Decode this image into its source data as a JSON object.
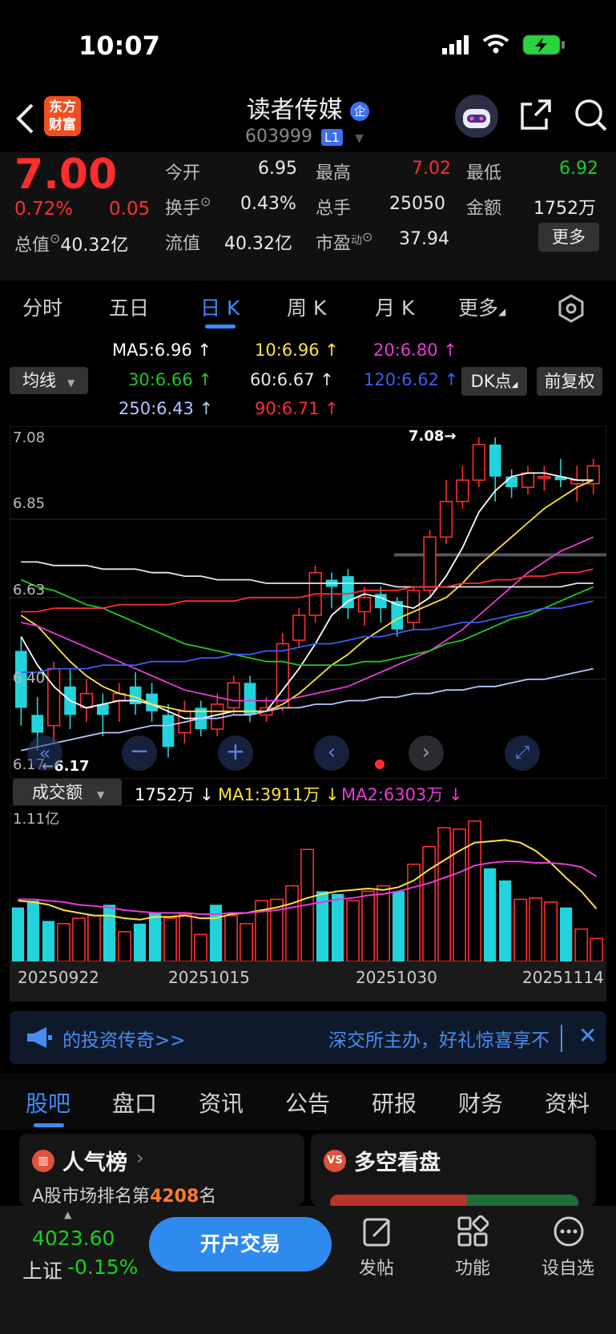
{
  "status_bar": {
    "time": "10:07"
  },
  "header": {
    "app_logo": "东方财富",
    "stock_name": "读者传媒",
    "name_badge": "企",
    "stock_code": "603999",
    "level_badge": "L1"
  },
  "quote": {
    "price": "7.00",
    "change_pct": "0.72%",
    "change_amt": "0.05",
    "open_label": "今开",
    "open": "6.95",
    "high_label": "最高",
    "high": "7.02",
    "low_label": "最低",
    "low": "6.92",
    "turnover_label": "换手",
    "turnover": "0.43%",
    "volume_label": "总手",
    "volume": "25050",
    "amount_label": "金额",
    "amount": "1752万",
    "total_cap_label": "总值",
    "total_cap": "40.32亿",
    "float_cap_label": "流值",
    "float_cap": "40.32亿",
    "pe_label": "市盈",
    "pe_sup": "动",
    "pe": "37.94",
    "more_button": "更多"
  },
  "period_tabs": [
    "分时",
    "五日",
    "日 K",
    "周 K",
    "月 K",
    "更多"
  ],
  "ma_legend": {
    "selector": "均线",
    "items": [
      {
        "text": "MA5:6.96 ↑",
        "color": "#ffffff"
      },
      {
        "text": "10:6.96 ↑",
        "color": "#ffe23a"
      },
      {
        "text": "20:6.80 ↑",
        "color": "#e83ad9"
      },
      {
        "text": "30:6.66 ↑",
        "color": "#1fc81f"
      },
      {
        "text": "60:6.67 ↑",
        "color": "#e6e6e6"
      },
      {
        "text": "120:6.62 ↑",
        "color": "#3a5ef5"
      },
      {
        "text": "250:6.43 ↑",
        "color": "#b3c8ff"
      },
      {
        "text": "90:6.71 ↑",
        "color": "#ff2d2d"
      }
    ],
    "dk_button": "DK点",
    "fq_button": "前复权"
  },
  "chart_data": [
    {
      "type": "candlestick",
      "y_ticks": [
        "7.08",
        "6.85",
        "6.63",
        "6.40",
        "6.17"
      ],
      "ylim": [
        6.17,
        7.08
      ],
      "max_label": "7.08→",
      "min_label": "←6.17",
      "x_labels": [
        "20250922",
        "20251015",
        "20251030",
        "20251114"
      ],
      "candles": [
        {
          "o": 6.48,
          "c": 6.32,
          "h": 6.52,
          "l": 6.27
        },
        {
          "o": 6.3,
          "c": 6.25,
          "h": 6.35,
          "l": 6.2
        },
        {
          "o": 6.27,
          "c": 6.43,
          "h": 6.45,
          "l": 6.22
        },
        {
          "o": 6.38,
          "c": 6.3,
          "h": 6.43,
          "l": 6.26
        },
        {
          "o": 6.32,
          "c": 6.36,
          "h": 6.4,
          "l": 6.28
        },
        {
          "o": 6.33,
          "c": 6.3,
          "h": 6.36,
          "l": 6.24
        },
        {
          "o": 6.34,
          "c": 6.36,
          "h": 6.39,
          "l": 6.28
        },
        {
          "o": 6.38,
          "c": 6.33,
          "h": 6.42,
          "l": 6.3
        },
        {
          "o": 6.36,
          "c": 6.31,
          "h": 6.39,
          "l": 6.28
        },
        {
          "o": 6.3,
          "c": 6.21,
          "h": 6.33,
          "l": 6.18
        },
        {
          "o": 6.25,
          "c": 6.31,
          "h": 6.34,
          "l": 6.22
        },
        {
          "o": 6.32,
          "c": 6.26,
          "h": 6.34,
          "l": 6.24
        },
        {
          "o": 6.26,
          "c": 6.33,
          "h": 6.36,
          "l": 6.24
        },
        {
          "o": 6.32,
          "c": 6.39,
          "h": 6.41,
          "l": 6.3
        },
        {
          "o": 6.39,
          "c": 6.3,
          "h": 6.41,
          "l": 6.28
        },
        {
          "o": 6.3,
          "c": 6.32,
          "h": 6.35,
          "l": 6.28
        },
        {
          "o": 6.32,
          "c": 6.5,
          "h": 6.53,
          "l": 6.31
        },
        {
          "o": 6.51,
          "c": 6.58,
          "h": 6.6,
          "l": 6.49
        },
        {
          "o": 6.58,
          "c": 6.7,
          "h": 6.72,
          "l": 6.56
        },
        {
          "o": 6.68,
          "c": 6.66,
          "h": 6.7,
          "l": 6.6
        },
        {
          "o": 6.69,
          "c": 6.6,
          "h": 6.71,
          "l": 6.57
        },
        {
          "o": 6.59,
          "c": 6.63,
          "h": 6.66,
          "l": 6.55
        },
        {
          "o": 6.64,
          "c": 6.6,
          "h": 6.66,
          "l": 6.56
        },
        {
          "o": 6.62,
          "c": 6.54,
          "h": 6.63,
          "l": 6.52
        },
        {
          "o": 6.56,
          "c": 6.65,
          "h": 6.66,
          "l": 6.54
        },
        {
          "o": 6.65,
          "c": 6.8,
          "h": 6.82,
          "l": 6.63
        },
        {
          "o": 6.8,
          "c": 6.9,
          "h": 6.96,
          "l": 6.78
        },
        {
          "o": 6.9,
          "c": 6.96,
          "h": 7.0,
          "l": 6.88
        },
        {
          "o": 6.96,
          "c": 7.06,
          "h": 7.08,
          "l": 6.94
        },
        {
          "o": 7.06,
          "c": 6.97,
          "h": 7.08,
          "l": 6.9
        },
        {
          "o": 6.97,
          "c": 6.94,
          "h": 6.99,
          "l": 6.91
        },
        {
          "o": 6.94,
          "c": 6.98,
          "h": 7.0,
          "l": 6.92
        },
        {
          "o": 6.97,
          "c": 6.97,
          "h": 7.0,
          "l": 6.93
        },
        {
          "o": 6.97,
          "c": 6.96,
          "h": 7.02,
          "l": 6.94
        },
        {
          "o": 6.95,
          "c": 6.96,
          "h": 7.0,
          "l": 6.9
        },
        {
          "o": 6.95,
          "c": 7.0,
          "h": 7.02,
          "l": 6.92
        }
      ],
      "ma_lines": [
        {
          "name": "MA5",
          "color": "#ffffff",
          "values": [
            6.52,
            6.44,
            6.38,
            6.34,
            6.32,
            6.33,
            6.34,
            6.34,
            6.33,
            6.31,
            6.29,
            6.29,
            6.3,
            6.31,
            6.31,
            6.31,
            6.37,
            6.43,
            6.5,
            6.58,
            6.62,
            6.64,
            6.63,
            6.61,
            6.6,
            6.63,
            6.69,
            6.77,
            6.87,
            6.93,
            6.97,
            6.98,
            6.98,
            6.97,
            6.96,
            6.96
          ]
        },
        {
          "name": "MA10",
          "color": "#ffe23a",
          "values": [
            6.58,
            6.55,
            6.5,
            6.45,
            6.41,
            6.38,
            6.36,
            6.35,
            6.33,
            6.32,
            6.31,
            6.31,
            6.31,
            6.31,
            6.31,
            6.31,
            6.33,
            6.36,
            6.4,
            6.44,
            6.47,
            6.51,
            6.54,
            6.57,
            6.59,
            6.61,
            6.63,
            6.67,
            6.72,
            6.76,
            6.8,
            6.84,
            6.88,
            6.91,
            6.94,
            6.96
          ]
        },
        {
          "name": "MA20",
          "color": "#e83ad9",
          "values": [
            6.56,
            6.55,
            6.53,
            6.51,
            6.49,
            6.47,
            6.45,
            6.43,
            6.41,
            6.39,
            6.37,
            6.36,
            6.35,
            6.34,
            6.34,
            6.34,
            6.34,
            6.35,
            6.36,
            6.37,
            6.38,
            6.4,
            6.42,
            6.44,
            6.46,
            6.48,
            6.51,
            6.54,
            6.58,
            6.62,
            6.66,
            6.7,
            6.73,
            6.76,
            6.78,
            6.8
          ]
        },
        {
          "name": "MA30",
          "color": "#1fc81f",
          "values": [
            6.68,
            6.66,
            6.65,
            6.63,
            6.61,
            6.6,
            6.58,
            6.56,
            6.54,
            6.52,
            6.5,
            6.49,
            6.48,
            6.47,
            6.46,
            6.45,
            6.45,
            6.44,
            6.44,
            6.44,
            6.44,
            6.45,
            6.45,
            6.46,
            6.47,
            6.48,
            6.5,
            6.51,
            6.53,
            6.55,
            6.57,
            6.58,
            6.6,
            6.62,
            6.64,
            6.66
          ]
        },
        {
          "name": "MA60",
          "color": "#e6e6e6",
          "values": [
            6.73,
            6.73,
            6.72,
            6.72,
            6.72,
            6.71,
            6.71,
            6.71,
            6.7,
            6.7,
            6.69,
            6.69,
            6.68,
            6.68,
            6.68,
            6.67,
            6.67,
            6.67,
            6.67,
            6.67,
            6.67,
            6.67,
            6.67,
            6.66,
            6.66,
            6.66,
            6.66,
            6.66,
            6.66,
            6.66,
            6.66,
            6.66,
            6.66,
            6.66,
            6.67,
            6.67
          ]
        },
        {
          "name": "MA90",
          "color": "#ff2d2d",
          "values": [
            6.59,
            6.59,
            6.6,
            6.6,
            6.6,
            6.6,
            6.61,
            6.61,
            6.61,
            6.61,
            6.62,
            6.62,
            6.62,
            6.62,
            6.63,
            6.63,
            6.63,
            6.63,
            6.64,
            6.64,
            6.64,
            6.65,
            6.65,
            6.65,
            6.66,
            6.66,
            6.66,
            6.67,
            6.67,
            6.68,
            6.68,
            6.69,
            6.69,
            6.7,
            6.7,
            6.71
          ]
        },
        {
          "name": "MA120",
          "color": "#3a5ef5",
          "values": [
            6.42,
            6.42,
            6.43,
            6.43,
            6.43,
            6.44,
            6.44,
            6.44,
            6.45,
            6.45,
            6.45,
            6.46,
            6.46,
            6.47,
            6.47,
            6.48,
            6.48,
            6.49,
            6.5,
            6.5,
            6.51,
            6.52,
            6.52,
            6.53,
            6.54,
            6.54,
            6.55,
            6.56,
            6.56,
            6.57,
            6.58,
            6.59,
            6.6,
            6.6,
            6.61,
            6.62
          ]
        },
        {
          "name": "MA250",
          "color": "#b3c8ff",
          "values": [
            6.2,
            6.21,
            6.22,
            6.23,
            6.24,
            6.25,
            6.25,
            6.26,
            6.27,
            6.27,
            6.28,
            6.29,
            6.29,
            6.3,
            6.3,
            6.31,
            6.32,
            6.32,
            6.33,
            6.33,
            6.34,
            6.34,
            6.35,
            6.35,
            6.36,
            6.36,
            6.37,
            6.37,
            6.38,
            6.38,
            6.39,
            6.4,
            6.4,
            6.41,
            6.42,
            6.43
          ]
        }
      ]
    },
    {
      "type": "bar",
      "title": "成交额",
      "current": "1752万 ↓",
      "ma1_label": "MA1:3911万 ↓",
      "ma2_label": "MA2:6303万 ↓",
      "y_ticks": [
        "1.11亿"
      ],
      "ylim": [
        0,
        1.11
      ],
      "values_yi": [
        0.4,
        0.45,
        0.3,
        0.28,
        0.32,
        0.34,
        0.42,
        0.22,
        0.28,
        0.36,
        0.32,
        0.35,
        0.2,
        0.42,
        0.34,
        0.28,
        0.45,
        0.46,
        0.56,
        0.83,
        0.52,
        0.5,
        0.45,
        0.52,
        0.56,
        0.52,
        0.72,
        0.85,
        0.99,
        0.98,
        1.04,
        0.69,
        0.6,
        0.46,
        0.47,
        0.44,
        0.4,
        0.24,
        0.17
      ],
      "colors": [
        "c",
        "c",
        "c",
        "r",
        "r",
        "r",
        "c",
        "r",
        "c",
        "c",
        "r",
        "r",
        "r",
        "c",
        "r",
        "r",
        "r",
        "r",
        "r",
        "r",
        "c",
        "c",
        "r",
        "r",
        "r",
        "c",
        "r",
        "r",
        "r",
        "r",
        "r",
        "c",
        "c",
        "r",
        "r",
        "r",
        "c",
        "r",
        "r"
      ],
      "ma1": [
        0.45,
        0.44,
        0.42,
        0.38,
        0.36,
        0.34,
        0.34,
        0.32,
        0.31,
        0.33,
        0.33,
        0.34,
        0.32,
        0.32,
        0.35,
        0.36,
        0.38,
        0.4,
        0.43,
        0.47,
        0.5,
        0.52,
        0.53,
        0.54,
        0.53,
        0.55,
        0.6,
        0.68,
        0.75,
        0.82,
        0.88,
        0.89,
        0.9,
        0.88,
        0.82,
        0.73,
        0.62,
        0.52,
        0.39
      ],
      "ma2": [
        0.46,
        0.46,
        0.45,
        0.44,
        0.42,
        0.41,
        0.4,
        0.38,
        0.37,
        0.36,
        0.36,
        0.36,
        0.35,
        0.35,
        0.36,
        0.36,
        0.37,
        0.38,
        0.4,
        0.42,
        0.44,
        0.46,
        0.47,
        0.49,
        0.5,
        0.52,
        0.55,
        0.58,
        0.62,
        0.66,
        0.71,
        0.73,
        0.74,
        0.74,
        0.73,
        0.73,
        0.72,
        0.7,
        0.63
      ]
    }
  ],
  "nav_controls": [
    "double-left",
    "zoom-out",
    "zoom-in",
    "step-left",
    "step-right",
    "fullscreen"
  ],
  "banner": {
    "left_text": "的投资传奇>>",
    "right_text": "深交所主办，好礼惊喜享不"
  },
  "content_tabs": [
    "股吧",
    "盘口",
    "资讯",
    "公告",
    "研报",
    "财务",
    "资料"
  ],
  "cards": {
    "popularity_title": "人气榜",
    "popularity_text_prefix": "A股市场排名第",
    "popularity_rank": "4208",
    "popularity_text_suffix": "名",
    "bullbear_title": "多空看盘"
  },
  "bottom_nav": {
    "index_value": "4023.60",
    "index_name": "上证",
    "index_change": "-0.15%",
    "trade_button": "开户交易",
    "post_label": "发帖",
    "function_label": "功能",
    "watchlist_label": "设自选"
  },
  "colors": {
    "up": "#ff2d2d",
    "down": "#22d3dc",
    "accent": "#3d8bff"
  }
}
